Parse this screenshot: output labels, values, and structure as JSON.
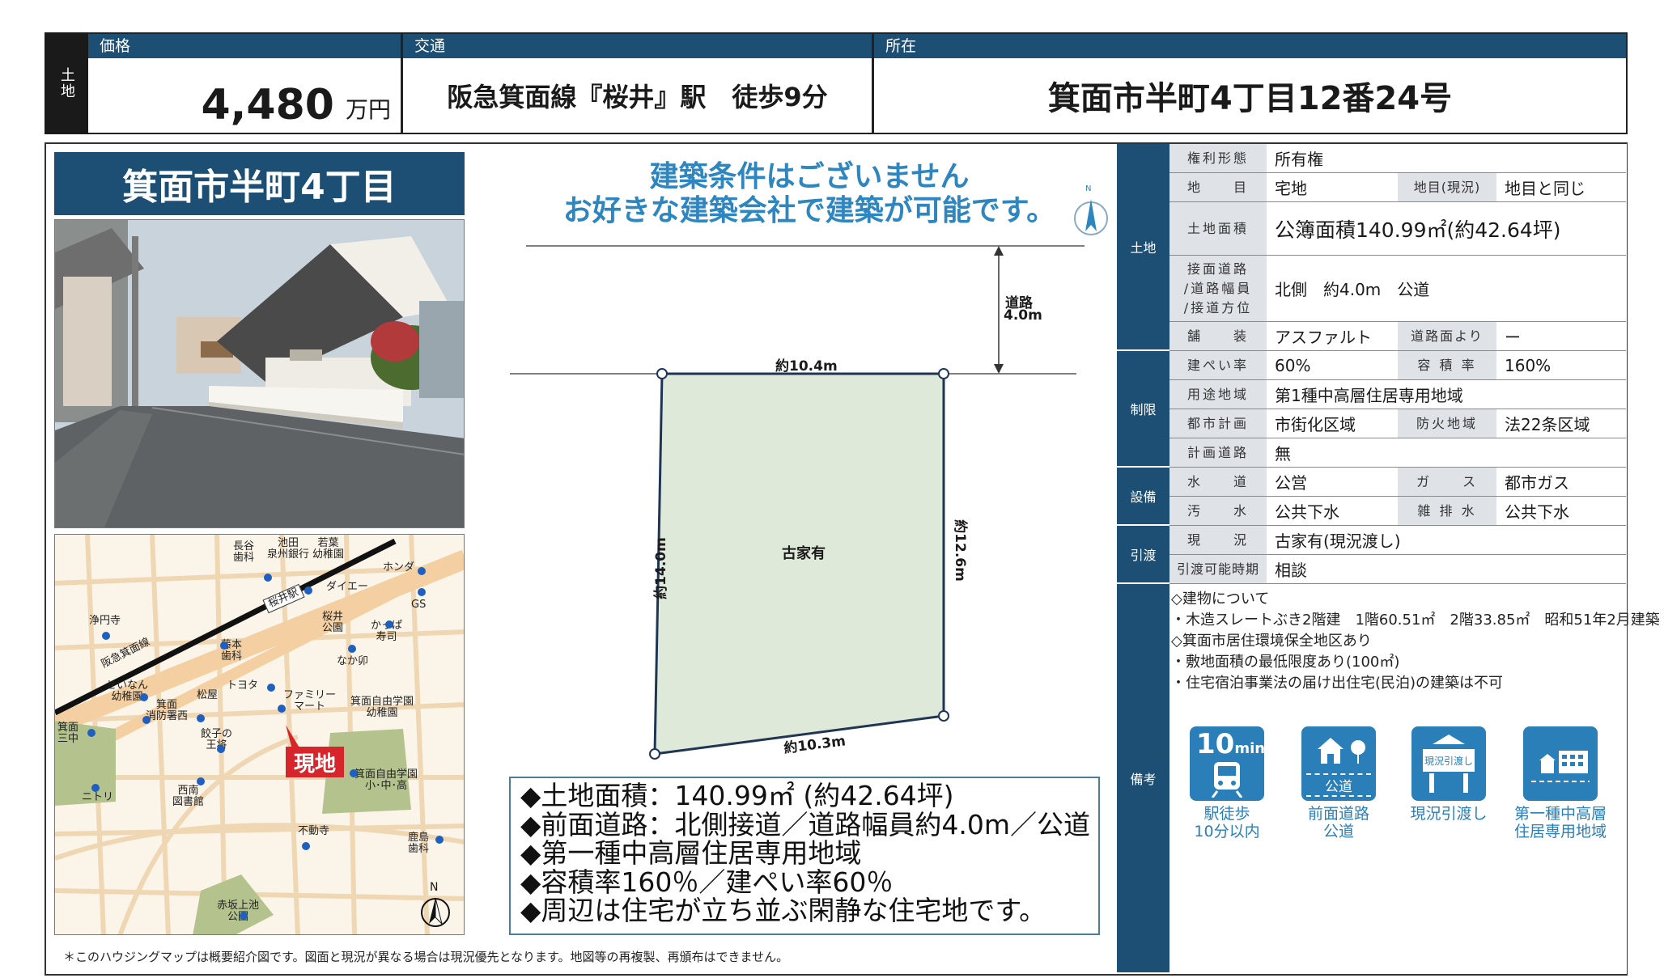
{
  "header": {
    "kind": "土地",
    "price_label": "価格",
    "price_value": "4,480",
    "price_unit": "万円",
    "transit_label": "交通",
    "transit_value": "阪急箕面線『桜井』駅　徒歩9分",
    "address_label": "所在",
    "address_value": "箕面市半町4丁目12番24号"
  },
  "title": "箕面市半町4丁目",
  "banner": {
    "line1": "建築条件はございません",
    "line2": "お好きな建築会社で建築が可能です。"
  },
  "plot": {
    "road_label": "道路",
    "road_width": "4.0m",
    "top_side": "約10.4m",
    "bottom_side": "約10.3m",
    "left_side": "約14.0m",
    "right_side": "約12.6m",
    "center_label": "古家有",
    "compass": "N"
  },
  "highlights": [
    "◆土地面積：140.99㎡ (約42.64坪)",
    "◆前面道路：北側接道／道路幅員約4.0m／公道",
    "◆第一種中高層住居専用地域",
    "◆容積率160％／建ぺい率60％",
    "◆周辺は住宅が立ち並ぶ閑静な住宅地です。"
  ],
  "spec": {
    "sections": {
      "land": "土地",
      "restrictions": "制限",
      "facilities": "設備",
      "handover": "引渡",
      "remarks": "備考"
    },
    "rows": {
      "rights_k": "権利形態",
      "rights_v": "所有権",
      "category_k": "地　　目",
      "category_v": "宅地",
      "current_cat_k": "地目(現況)",
      "current_cat_v": "地目と同じ",
      "area_k": "土地面積",
      "area_v": "公簿面積140.99㎡(約42.64坪)",
      "road_k1": "接面道路",
      "road_k2": "/道路幅員",
      "road_k3": "/接道方位",
      "road_v": "北側　約4.0m　公道",
      "pavement_k": "舗　　装",
      "pavement_v": "アスファルト",
      "from_road_k": "道路面より",
      "from_road_v": "ー",
      "coverage_k": "建ぺい率",
      "coverage_v": "60%",
      "far_k": "容 積 率",
      "far_v": "160%",
      "zoning_k": "用途地域",
      "zoning_v": "第1種中高層住居専用地域",
      "city_plan_k": "都市計画",
      "city_plan_v": "市街化区域",
      "fire_k": "防火地域",
      "fire_v": "法22条区域",
      "planned_road_k": "計画道路",
      "planned_road_v": "無",
      "water_k": "水　　道",
      "water_v": "公営",
      "gas_k": "ガ　　ス",
      "gas_v": "都市ガス",
      "sewage_k": "汚　　水",
      "sewage_v": "公共下水",
      "drain_k": "雑 排 水",
      "drain_v": "公共下水",
      "status_k": "現　　況",
      "status_v": "古家有(現況渡し)",
      "handover_k": "引渡可能時期",
      "handover_v": "相談"
    }
  },
  "notes": [
    "◇建物について",
    "・木造スレートぶき2階建　1階60.51㎡　2階33.85㎡　昭和51年2月建築",
    "◇箕面市居住環境保全地区あり",
    "・敷地面積の最低限度あり(100㎡)",
    "・住宅宿泊事業法の届け出住宅(民泊)の建築は不可"
  ],
  "badges": [
    {
      "big": "10",
      "small": "min",
      "cap1": "駅徒歩",
      "cap2": "10分以内"
    },
    {
      "inner": "公道",
      "cap1": "前面道路",
      "cap2": "公道"
    },
    {
      "inner": "現況引渡し",
      "cap1": "現況引渡し",
      "cap2": ""
    },
    {
      "cap1": "第一種中高層",
      "cap2": "住居専用地域"
    }
  ],
  "map": {
    "station": "桜井駅",
    "line": "阪急箕面線",
    "site": "現地",
    "north": "N",
    "places": [
      "長谷\n歯科",
      "池田\n泉州銀行",
      "若葉\n幼稚園",
      "ホンダ",
      "ダイエー",
      "GS",
      "浄円寺",
      "桜井\n公園",
      "かっぱ\n寿司",
      "藤本\n歯科",
      "なか卯",
      "せいなん\n幼稚園",
      "箕面\n消防署西",
      "松屋",
      "トヨタ",
      "ファミリー\nマート",
      "箕面自由学園\n幼稚園",
      "箕面\n三中",
      "餃子の\n王将",
      "箕面自由学園\n小･中･高",
      "西南\n図書館",
      "ニトリ",
      "不動寺",
      "鹿島\n歯科",
      "赤坂上池\n公園"
    ]
  },
  "footer": "＊このハウジングマップは概要紹介図です。図面と現況が異なる場合は現況優先となります。地図等の再複製、再頒布はできません。"
}
